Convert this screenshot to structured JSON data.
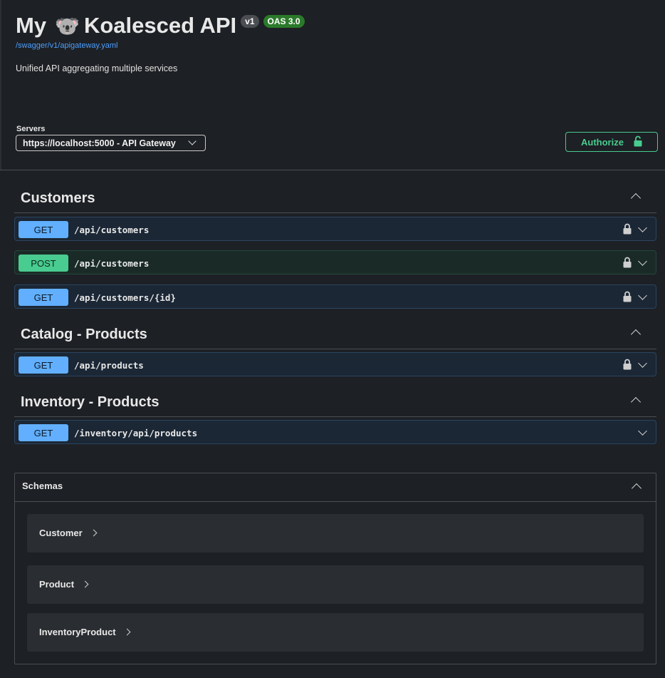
{
  "info": {
    "title_prefix": "My",
    "title_emoji": "🐨",
    "title_main": "Koalesced API",
    "version_badge": "v1",
    "oas_badge": "OAS 3.0",
    "spec_link": "/swagger/v1/apigateway.yaml",
    "description": "Unified API aggregating multiple services"
  },
  "servers": {
    "label": "Servers",
    "selected": "https://localhost:5000 - API Gateway"
  },
  "authorize": {
    "label": "Authorize"
  },
  "tags": [
    {
      "name": "Customers",
      "operations": [
        {
          "method": "GET",
          "path": "/api/customers",
          "locked": true
        },
        {
          "method": "POST",
          "path": "/api/customers",
          "locked": true
        },
        {
          "method": "GET",
          "path": "/api/customers/{id}",
          "locked": true
        }
      ]
    },
    {
      "name": "Catalog - Products",
      "operations": [
        {
          "method": "GET",
          "path": "/api/products",
          "locked": true
        }
      ]
    },
    {
      "name": "Inventory - Products",
      "operations": [
        {
          "method": "GET",
          "path": "/inventory/api/products",
          "locked": false
        }
      ]
    }
  ],
  "schemas": {
    "title": "Schemas",
    "models": [
      "Customer",
      "Product",
      "InventoryProduct"
    ]
  },
  "colors": {
    "get": "#61affe",
    "post": "#49cc90",
    "authorize": "#49cc90",
    "link": "#4d9fff"
  }
}
